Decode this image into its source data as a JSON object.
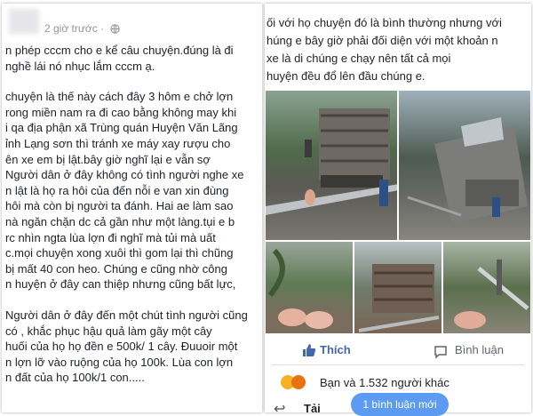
{
  "left_post": {
    "time": "2 giờ trước ·",
    "paragraphs": [
      "n phép cccm cho e kể câu chuyện.đúng là đi\nnghề lái nó nhục lắm cccm ạ.",
      "chuyện là thế này cách đây 3 hôm e chở lợn\nrong miền nam ra đi cao bằng không may khi\ni qa địa phận xã Trùng quán Huyện Văn Lãng\nỉnh Lạng sơn thì tránh xe máy xay rượu cho\nên xe em bị lật.bây giờ nghĩ lại e vẫn sợ\nNgười dân ở đây không có tình người nghe xe\nn lật là họ ra hôi của đến nỗi e van xin đùng\nhôi mà còn bị người ta đánh. Hai ae làm sao\nnà ngăn chặn dc cả gần như một làng.tụi e b\nrc nhìn ngta lùa lợn đi nghĩ mà tủi mà uất\nc.mọi chuyện xong xuôi thì gom lại thì chũng\nbị mất 40 con heo. Chúng e cũng nhờ công\nn huyện ở đây can thiệp nhưng cũng bất lực,",
      "Người dân ở đây đến một chút tình người cũng\ncó , khắc phục hậu quả làm gãy một cây\nhuối của họ họ đền e 500k/ 1 cây. Đuuoir một\nn lợn lỡ vào ruộng của họ 100k. Lùa con lợn\nn đất của họ 100k/1 con....."
    ]
  },
  "right_post": {
    "text": "ối với họ chuyện đó là bình thường nhưng với\nhúng e bây giờ phải đối diện với một khoản n\nxe là di chúng e chạy nên tất cả mọi\nhuyện đều đổ lên đầu chúng e.",
    "actions": {
      "like": "Thích",
      "comment": "Bình luận"
    },
    "reactions_text": "Bạn và 1.532 người khác",
    "load_text": "Tải các",
    "new_comment_pill": "1 bình luận mới"
  },
  "colors": {
    "like_blue": "#4267b2",
    "pill_blue": "#5b9cf2",
    "sad": "#f7b125",
    "angry": "#e9710f"
  },
  "icons": [
    "globe-icon",
    "like-icon",
    "comment-icon",
    "sad-reaction-icon",
    "angry-reaction-icon",
    "back-arrow-icon"
  ]
}
